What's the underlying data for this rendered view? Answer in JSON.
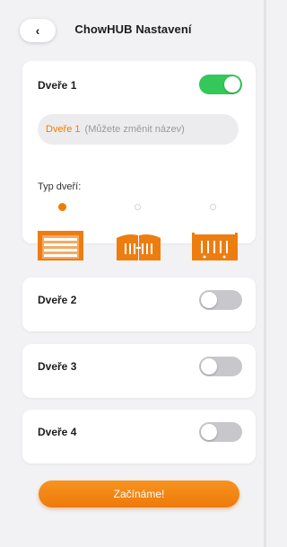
{
  "header": {
    "back_icon": "‹",
    "title": "ChowHUB Nastavení"
  },
  "doors": [
    {
      "label": "Dveře 1",
      "enabled": true
    },
    {
      "label": "Dveře 2",
      "enabled": false
    },
    {
      "label": "Dveře 3",
      "enabled": false
    },
    {
      "label": "Dveře 4",
      "enabled": false
    }
  ],
  "door1": {
    "name_value": "Dveře 1",
    "name_hint": "(Můžete změnit název)",
    "type_label": "Typ dveří:",
    "door_types": [
      {
        "icon": "garage-door-icon",
        "selected": true
      },
      {
        "icon": "double-gate-icon",
        "selected": false
      },
      {
        "icon": "sliding-gate-icon",
        "selected": false
      }
    ]
  },
  "start_button": {
    "label": "Začínáme!"
  },
  "colors": {
    "accent": "#f07d00",
    "toggle_on": "#34c759",
    "toggle_off": "#c8c8cc",
    "background": "#f2f2f4"
  }
}
